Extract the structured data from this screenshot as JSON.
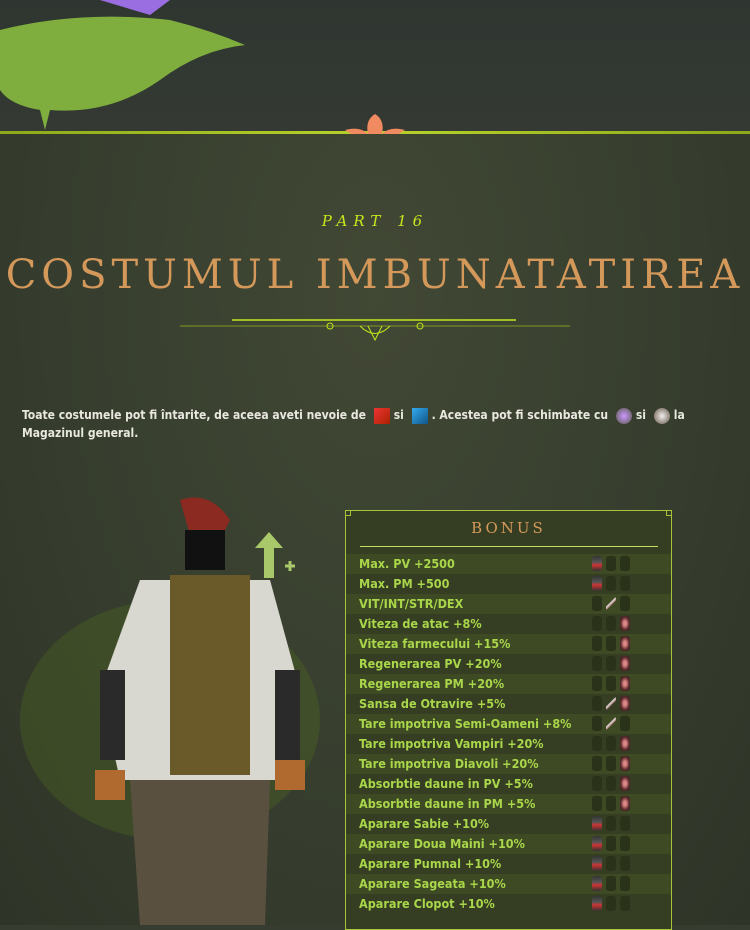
{
  "header": {
    "part": "PART 16",
    "title": "COSTUMUL IMBUNATATIREA"
  },
  "intro": {
    "t1": "Toate costumele pot fi întarite, de aceea aveti nevoie de",
    "si1": "si",
    "t2": ". Acestea pot fi schimbate cu",
    "si2": "si",
    "t3": "la Magazinul general.",
    "icons": [
      "red-scroll-icon",
      "blue-scroll-icon",
      "purple-item-icon",
      "white-item-icon"
    ]
  },
  "bonus": {
    "title": "BONUS",
    "rows": [
      {
        "label": "Max. PV +2500",
        "slots": [
          "armor"
        ]
      },
      {
        "label": "Max. PM +500",
        "slots": [
          "armor"
        ]
      },
      {
        "label": "VIT/INT/STR/DEX",
        "slots": [
          "weapon"
        ]
      },
      {
        "label": "Viteza de atac +8%",
        "slots": [
          "hair"
        ]
      },
      {
        "label": "Viteza farmecului +15%",
        "slots": [
          "hair"
        ]
      },
      {
        "label": "Regenerarea PV +20%",
        "slots": [
          "hair"
        ]
      },
      {
        "label": "Regenerarea PM +20%",
        "slots": [
          "hair"
        ]
      },
      {
        "label": "Sansa de Otravire +5%",
        "slots": [
          "weapon",
          "hair"
        ]
      },
      {
        "label": "Tare impotriva Semi-Oameni +8%",
        "slots": [
          "weapon"
        ]
      },
      {
        "label": "Tare impotriva Vampiri +20%",
        "slots": [
          "hair"
        ]
      },
      {
        "label": "Tare impotriva Diavoli +20%",
        "slots": [
          "hair"
        ]
      },
      {
        "label": "Absorbtie daune in PV +5%",
        "slots": [
          "hair"
        ]
      },
      {
        "label": "Absorbtie daune in PM +5%",
        "slots": [
          "hair"
        ]
      },
      {
        "label": "Aparare Sabie +10%",
        "slots": [
          "armor"
        ]
      },
      {
        "label": "Aparare Doua Maini +10%",
        "slots": [
          "armor"
        ]
      },
      {
        "label": "Aparare Pumnal +10%",
        "slots": [
          "armor"
        ]
      },
      {
        "label": "Aparare Sageata +10%",
        "slots": [
          "armor"
        ]
      },
      {
        "label": "Aparare Clopot +10%",
        "slots": [
          "armor"
        ]
      }
    ]
  }
}
